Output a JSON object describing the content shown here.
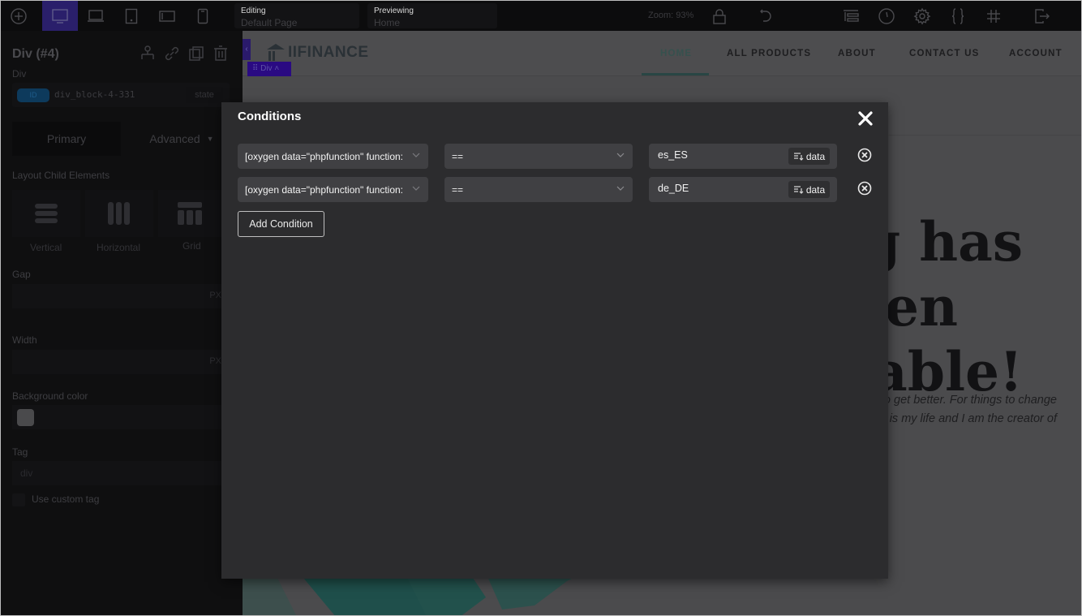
{
  "topbar": {
    "editing_label": "Editing",
    "editing_value": "Default Page",
    "previewing_label": "Previewing",
    "previewing_value": "Home",
    "zoom_text": "Zoom: 93%",
    "devices": [
      "desktop",
      "laptop",
      "tablet",
      "tablet-landscape",
      "mobile"
    ],
    "active_device": "desktop",
    "accent_color": "#2a1f6b"
  },
  "left_panel": {
    "title": "Div (#4)",
    "subtitle": "Div",
    "selector": {
      "badge": "ID",
      "name": "div_block-4-331",
      "state_label": "state"
    },
    "tabs": {
      "primary": "Primary",
      "advanced": "Advanced"
    },
    "layout_label": "Layout Child Elements",
    "layout_options": [
      "Vertical",
      "Horizontal",
      "Grid"
    ],
    "gap_label": "Gap",
    "gap_unit": "PX",
    "width_label": "Width",
    "width_unit": "PX",
    "bg_color_label": "Background color",
    "tag_label": "Tag",
    "tag_value": "div",
    "custom_tag_label": "Use custom tag"
  },
  "canvas": {
    "logo_text": "IIFINANCE",
    "nav": [
      "HOME",
      "ALL PRODUCTS",
      "ABOUT",
      "CONTACT US",
      "ACCOUNT"
    ],
    "active_nav": "HOME",
    "element_badge": "Div",
    "hero_lines": [
      "g has",
      "een",
      "table!"
    ],
    "hero_sub_lines": [
      "o get better. For things to change",
      "is my life and I am the creator of"
    ]
  },
  "modal": {
    "title": "Conditions",
    "conditions": [
      {
        "field": "[oxygen data=\"phpfunction\" function:",
        "operator": "==",
        "value": "es_ES",
        "data_button": "data"
      },
      {
        "field": "[oxygen data=\"phpfunction\" function:",
        "operator": "==",
        "value": "de_DE",
        "data_button": "data"
      }
    ],
    "add_condition_label": "Add Condition"
  }
}
